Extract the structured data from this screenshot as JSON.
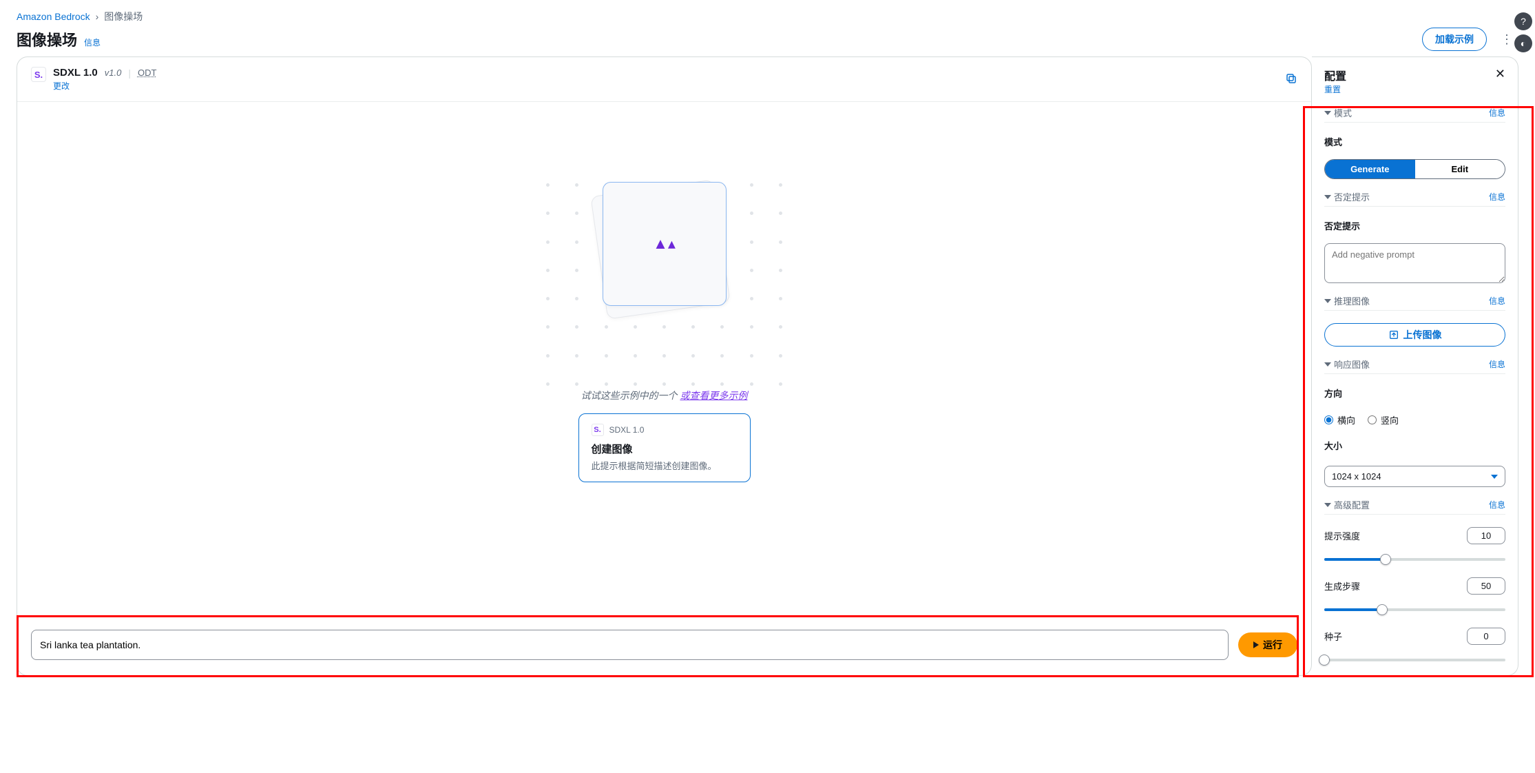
{
  "breadcrumb": {
    "root": "Amazon Bedrock",
    "current": "图像操场"
  },
  "page": {
    "title": "图像操场",
    "info": "信息",
    "load_examples": "加载示例"
  },
  "model": {
    "icon_letter": "S.",
    "name": "SDXL 1.0",
    "version": "v1.0",
    "odt": "ODT",
    "change": "更改"
  },
  "canvas": {
    "hint_prefix": "试试这些示例中的一个 ",
    "hint_link": "或查看更多示例",
    "example": {
      "model": "SDXL 1.0",
      "title": "创建图像",
      "desc": "此提示根据简短描述创建图像。"
    }
  },
  "prompt": {
    "value": "Sri lanka tea plantation.",
    "run": "运行"
  },
  "config": {
    "title": "配置",
    "reset": "重置",
    "info": "信息",
    "mode": {
      "section": "模式",
      "label": "模式",
      "generate": "Generate",
      "edit": "Edit",
      "active": "generate"
    },
    "neg": {
      "section": "否定提示",
      "label": "否定提示",
      "placeholder": "Add negative prompt"
    },
    "infer": {
      "section": "推理图像",
      "upload": "上传图像"
    },
    "resp": {
      "section": "响应图像",
      "orientation_label": "方向",
      "orientation_h": "横向",
      "orientation_v": "竖向",
      "orientation_value": "h",
      "size_label": "大小",
      "size_value": "1024 x 1024"
    },
    "adv": {
      "section": "高级配置",
      "strength_label": "提示强度",
      "strength_value": "10",
      "strength_fill_pct": 34,
      "steps_label": "生成步骤",
      "steps_value": "50",
      "steps_fill_pct": 32,
      "seed_label": "种子",
      "seed_value": "0",
      "seed_fill_pct": 0
    }
  }
}
